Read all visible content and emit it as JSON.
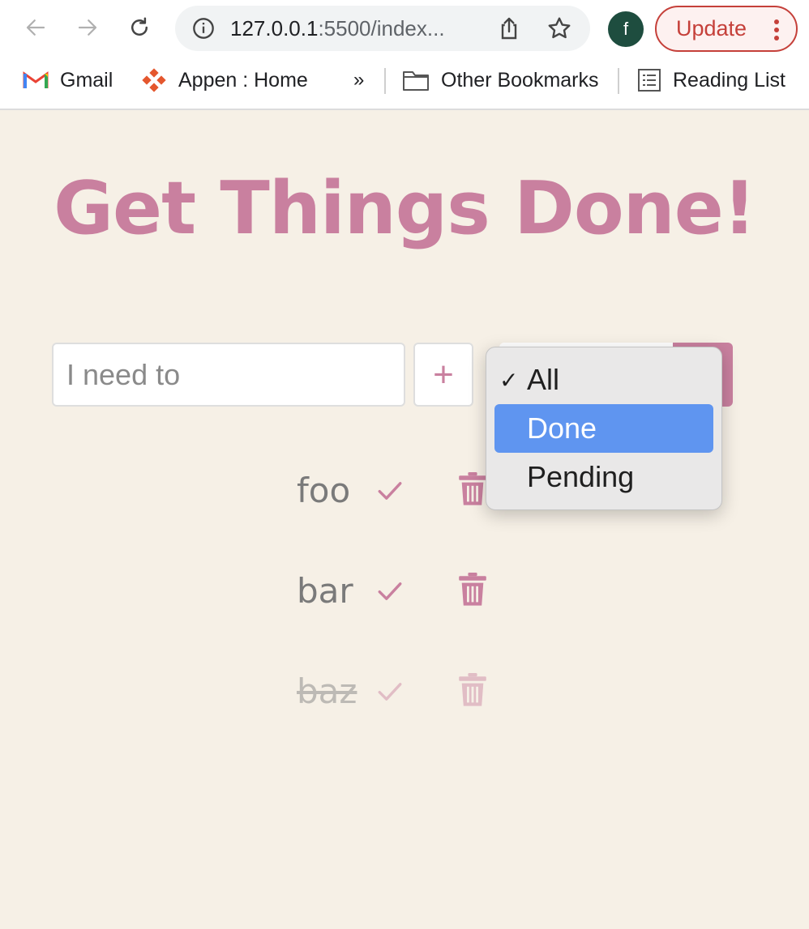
{
  "browser": {
    "url_host": "127.0.0.1",
    "url_rest": ":5500/index...",
    "profile_initial": "f",
    "update_label": "Update",
    "bookmarks": [
      {
        "label": "Gmail",
        "icon": "gmail-icon"
      },
      {
        "label": "Appen : Home",
        "icon": "appen-icon"
      },
      {
        "label": "»",
        "icon": "chevron-double-right-icon"
      },
      {
        "label": "Other Bookmarks",
        "icon": "folder-icon"
      },
      {
        "label": "Reading List",
        "icon": "reading-list-icon"
      }
    ]
  },
  "app": {
    "title": "Get Things Done!",
    "input_placeholder": "I need to",
    "add_button_symbol": "+",
    "accent_color": "#c9809f",
    "background_color": "#f6f0e6"
  },
  "todos": [
    {
      "text": "foo",
      "completed": false
    },
    {
      "text": "bar",
      "completed": false
    },
    {
      "text": "baz",
      "completed": true
    }
  ],
  "filter": {
    "selected": "All",
    "highlighted": "Done",
    "options": [
      {
        "label": "All",
        "checked": true,
        "highlighted": false
      },
      {
        "label": "Done",
        "checked": false,
        "highlighted": true
      },
      {
        "label": "Pending",
        "checked": false,
        "highlighted": false
      }
    ],
    "check_mark": "✓"
  }
}
